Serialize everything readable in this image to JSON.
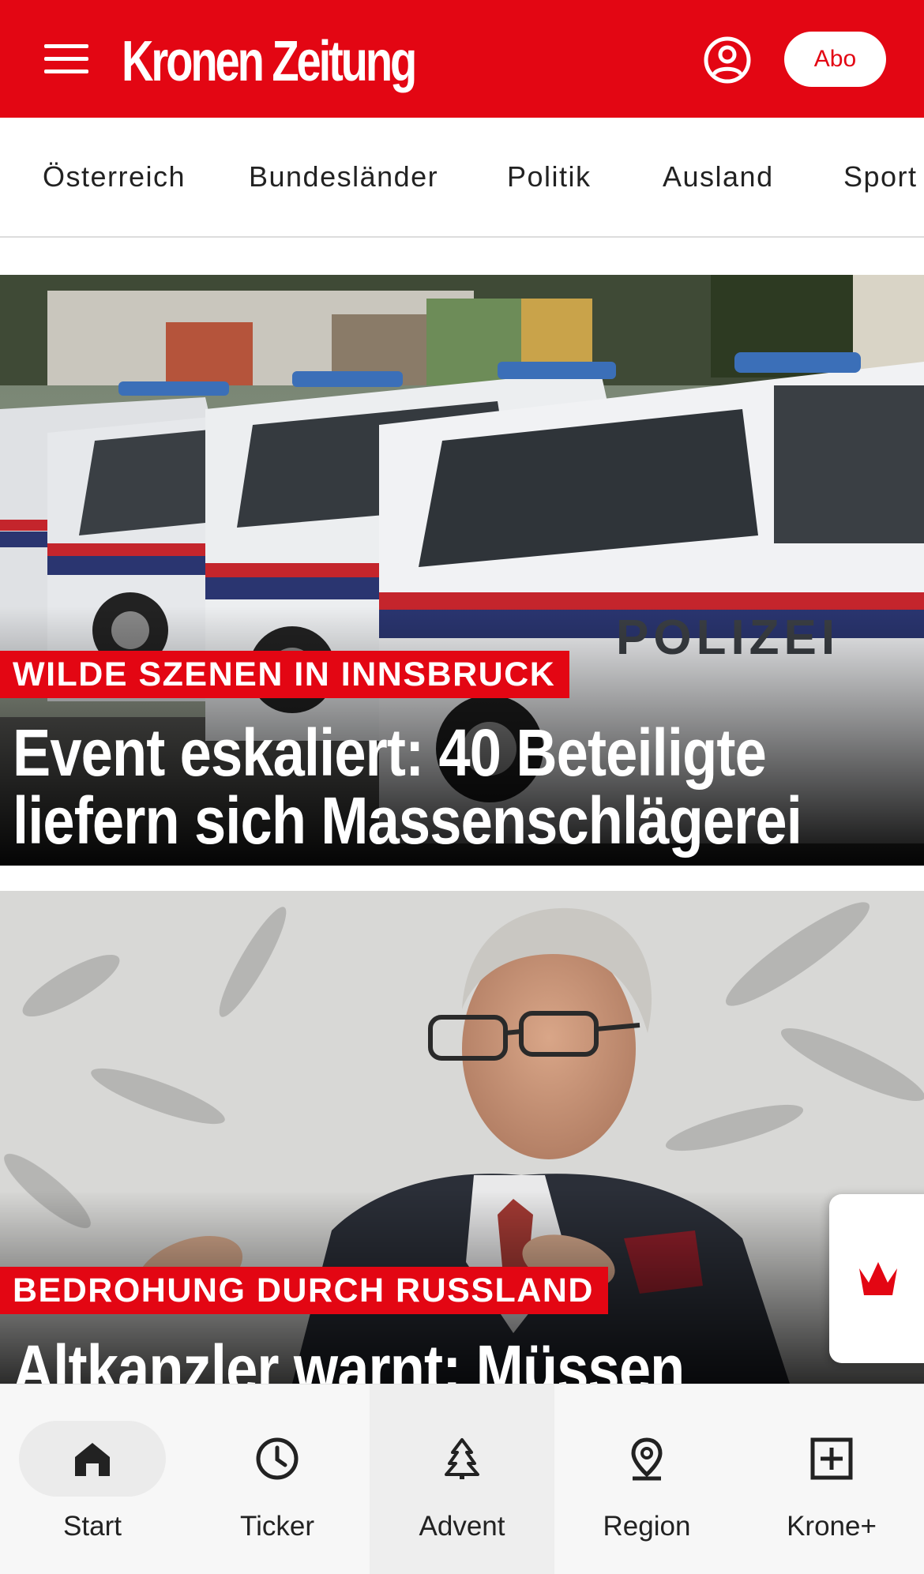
{
  "header": {
    "logo_text": "Kronen Zeitung",
    "abo_label": "Abo",
    "brand_color": "#e30613"
  },
  "nav": {
    "items": [
      "Österreich",
      "Bundesländer",
      "Politik",
      "Ausland",
      "Sport"
    ]
  },
  "articles": [
    {
      "kicker": "WILDE SZENEN IN INNSBRUCK",
      "headline": "Event eskaliert: 40 Beteiligte liefern sich Massenschlägerei",
      "image_text": "POLIZEI"
    },
    {
      "kicker": "BEDROHUNG DURCH RUSSLAND",
      "headline": "Altkanzler warnt: Müssen"
    }
  ],
  "bottom_nav": {
    "items": [
      {
        "label": "Start",
        "icon": "home-icon",
        "active": true
      },
      {
        "label": "Ticker",
        "icon": "clock-icon"
      },
      {
        "label": "Advent",
        "icon": "tree-icon"
      },
      {
        "label": "Region",
        "icon": "location-pin-icon"
      },
      {
        "label": "Krone+",
        "icon": "plus-box-icon"
      }
    ]
  },
  "krone_plus_tab": {
    "icon": "crown-icon"
  }
}
